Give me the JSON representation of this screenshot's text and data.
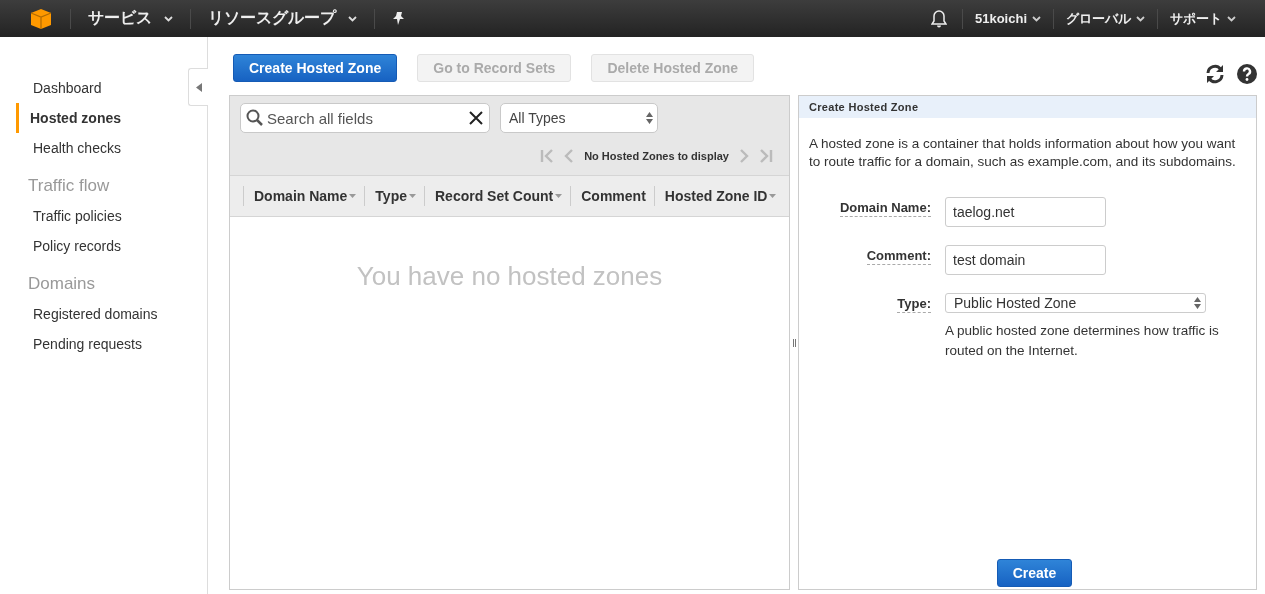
{
  "top_nav": {
    "left_menus": [
      {
        "label": "サービス"
      },
      {
        "label": "リソースグループ"
      }
    ],
    "right_menus": [
      {
        "label": "51koichi"
      },
      {
        "label": "グローバル"
      },
      {
        "label": "サポート"
      }
    ]
  },
  "sidebar": {
    "sections": [
      {
        "items": [
          {
            "label": "Dashboard",
            "selected": false
          },
          {
            "label": "Hosted zones",
            "selected": true
          },
          {
            "label": "Health checks",
            "selected": false
          }
        ]
      },
      {
        "heading": "Traffic flow",
        "items": [
          {
            "label": "Traffic policies",
            "selected": false
          },
          {
            "label": "Policy records",
            "selected": false
          }
        ]
      },
      {
        "heading": "Domains",
        "items": [
          {
            "label": "Registered domains",
            "selected": false
          },
          {
            "label": "Pending requests",
            "selected": false
          }
        ]
      }
    ]
  },
  "toolbar": {
    "buttons": [
      {
        "label": "Create Hosted Zone",
        "kind": "primary",
        "disabled": false
      },
      {
        "label": "Go to Record Sets",
        "kind": "secondary",
        "disabled": true
      },
      {
        "label": "Delete Hosted Zone",
        "kind": "secondary",
        "disabled": true
      }
    ]
  },
  "zone_list": {
    "search": {
      "placeholder": "Search all fields"
    },
    "type_filter": "All Types",
    "pager_text": "No Hosted Zones to display",
    "columns": [
      {
        "label": "Domain Name",
        "sortable": true
      },
      {
        "label": "Type",
        "sortable": true
      },
      {
        "label": "Record Set Count",
        "sortable": true
      },
      {
        "label": "Comment",
        "sortable": false
      },
      {
        "label": "Hosted Zone ID",
        "sortable": true
      }
    ],
    "empty_message": "You have no hosted zones"
  },
  "create_form": {
    "title": "Create Hosted Zone",
    "description": "A hosted zone is a container that holds information about how you want to route traffic for a domain, such as example.com, and its subdomains.",
    "fields": [
      {
        "label": "Domain Name:",
        "kind": "text",
        "value": "taelog.net"
      },
      {
        "label": "Comment:",
        "kind": "text",
        "value": "test domain"
      },
      {
        "label": "Type:",
        "kind": "select",
        "value": "Public Hosted Zone",
        "help": "A public hosted zone determines how traffic is routed on the Internet."
      }
    ],
    "submit": "Create"
  }
}
